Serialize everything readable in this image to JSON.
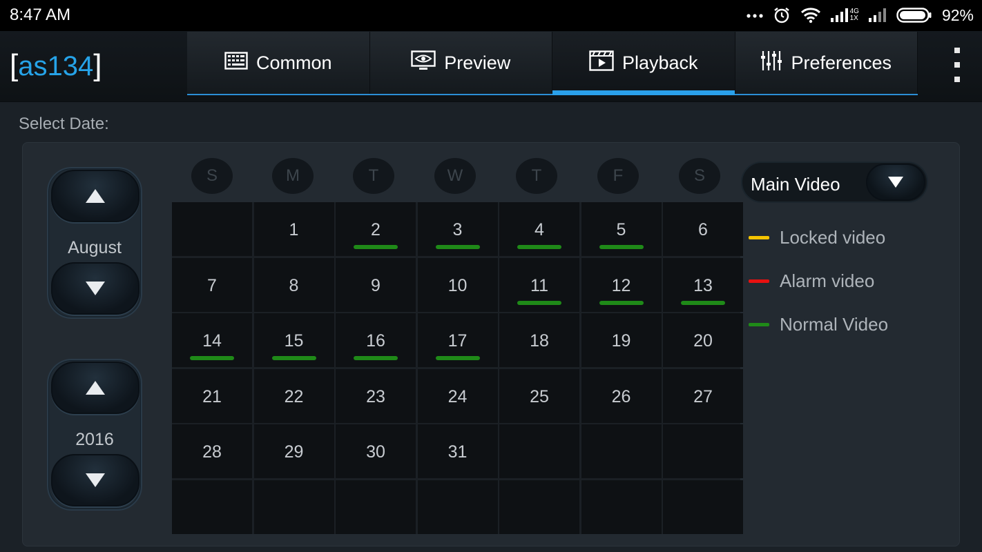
{
  "status_bar": {
    "time": "8:47 AM",
    "network_4g": "4G",
    "network_1x": "1X",
    "battery": "92%"
  },
  "app": {
    "logo_open": "[",
    "logo_name": "as134",
    "logo_close": "]"
  },
  "tabs": [
    {
      "label": "Common",
      "icon": "grid-list-icon"
    },
    {
      "label": "Preview",
      "icon": "monitor-eye-icon"
    },
    {
      "label": "Playback",
      "icon": "film-play-icon",
      "active": true
    },
    {
      "label": "Preferences",
      "icon": "sliders-icon"
    }
  ],
  "select_date_label": "Select Date:",
  "month": "August",
  "year": "2016",
  "weekdays": [
    "S",
    "M",
    "T",
    "W",
    "T",
    "F",
    "S"
  ],
  "calendar_days": [
    "",
    "1",
    "2",
    "3",
    "4",
    "5",
    "6",
    "7",
    "8",
    "9",
    "10",
    "11",
    "12",
    "13",
    "14",
    "15",
    "16",
    "17",
    "18",
    "19",
    "20",
    "21",
    "22",
    "23",
    "24",
    "25",
    "26",
    "27",
    "28",
    "29",
    "30",
    "31",
    "",
    "",
    "",
    "",
    "",
    "",
    "",
    "",
    "",
    ""
  ],
  "normal_video_days": [
    "2",
    "3",
    "4",
    "5",
    "11",
    "12",
    "13",
    "14",
    "15",
    "16",
    "17"
  ],
  "stream": {
    "selected": "Main Video"
  },
  "legend": [
    {
      "label": "Locked video",
      "color": "#f5c400"
    },
    {
      "label": "Alarm video",
      "color": "#e81010"
    },
    {
      "label": "Normal Video",
      "color": "#1f8a18"
    }
  ],
  "colors": {
    "accent": "#2aa0ea",
    "logo": "#26a3e8",
    "normal_bar": "#1f8a18"
  }
}
